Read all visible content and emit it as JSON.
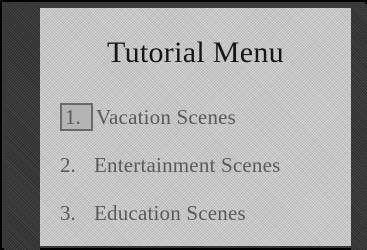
{
  "menu": {
    "title": "Tutorial Menu",
    "items": [
      {
        "number": "1.",
        "label": "Vacation Scenes",
        "selected": true
      },
      {
        "number": "2.",
        "label": "Entertainment Scenes",
        "selected": false
      },
      {
        "number": "3.",
        "label": "Education Scenes",
        "selected": false
      }
    ]
  }
}
